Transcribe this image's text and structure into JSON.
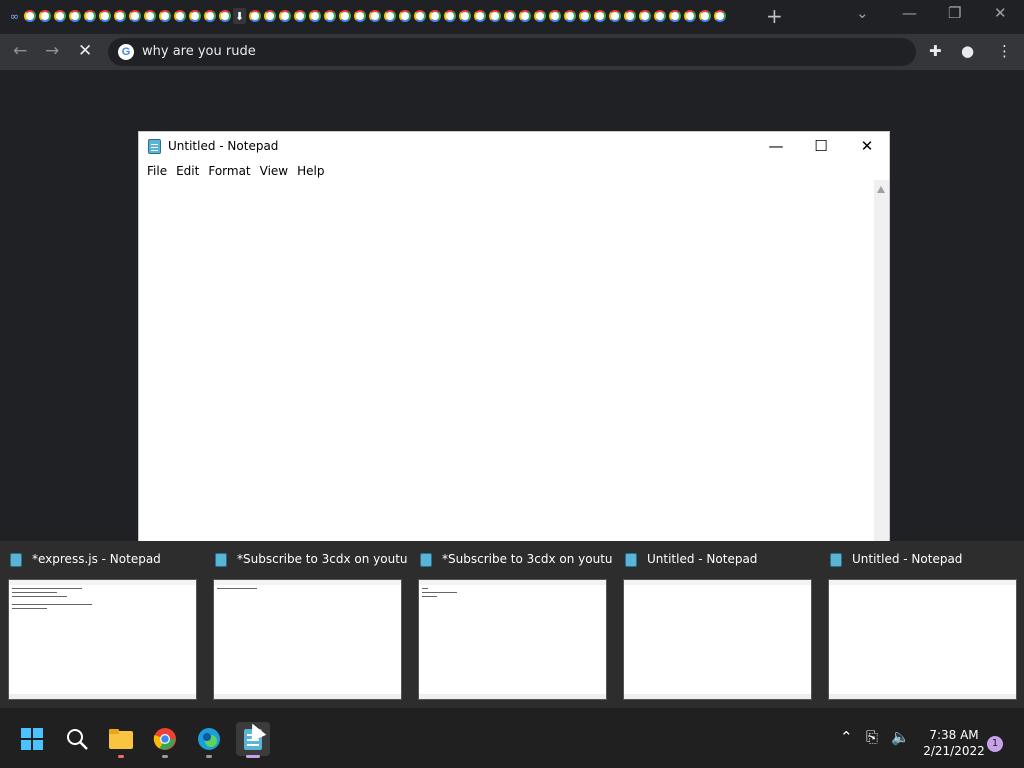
{
  "browser": {
    "omnibox_text": "why are you rude",
    "new_tab_icon": "plus-icon",
    "back_icon": "arrow-left-icon",
    "forward_icon": "arrow-right-icon",
    "stop_icon": "close-icon"
  },
  "notepad": {
    "title": "Untitled - Notepad",
    "menu": [
      "File",
      "Edit",
      "Format",
      "View",
      "Help"
    ]
  },
  "thumbnails": [
    {
      "title": "*express.js - Notepad"
    },
    {
      "title": "*Subscribe to 3cdx on youtu..."
    },
    {
      "title": "*Subscribe to 3cdx on youtu..."
    },
    {
      "title": "Untitled - Notepad"
    },
    {
      "title": "Untitled - Notepad"
    }
  ],
  "taskbar": {
    "time": "7:38 AM",
    "date": "2/21/2022",
    "notification_count": "1"
  },
  "colors": {
    "chrome_dark": "#202124",
    "toolbar": "#35363a",
    "taskbar": "#202020",
    "notepad_icon": "#5ab4d6"
  }
}
